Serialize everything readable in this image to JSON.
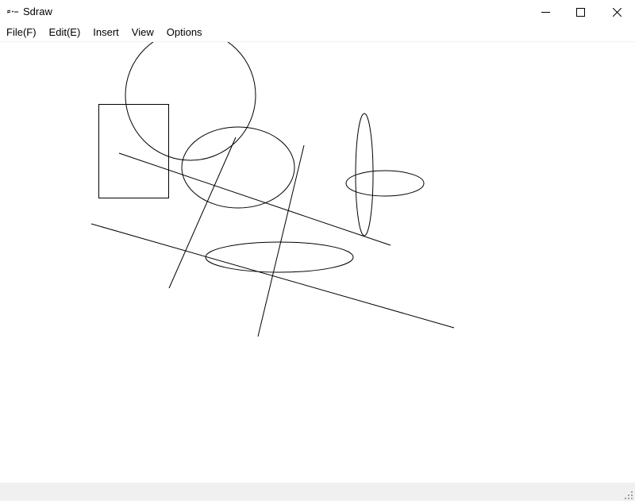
{
  "window": {
    "title": "Sdraw",
    "app_icon": "sdraw-app-icon",
    "controls": {
      "minimize_icon": "minimize-icon",
      "maximize_icon": "maximize-icon",
      "close_icon": "close-icon"
    }
  },
  "menu": {
    "items": [
      {
        "label": "File(F)"
      },
      {
        "label": "Edit(E)"
      },
      {
        "label": "Insert"
      },
      {
        "label": "View"
      },
      {
        "label": "Options"
      }
    ]
  },
  "canvas": {
    "background": "#ffffff",
    "stroke": "#000000",
    "shapes": [
      {
        "type": "ellipse",
        "name": "shape-ellipse-large-circle"
      },
      {
        "type": "rect",
        "name": "shape-rectangle"
      },
      {
        "type": "ellipse",
        "name": "shape-ellipse-middle"
      },
      {
        "type": "ellipse",
        "name": "shape-ellipse-vertical"
      },
      {
        "type": "ellipse",
        "name": "shape-ellipse-small-horizontal"
      },
      {
        "type": "ellipse",
        "name": "shape-ellipse-flat"
      },
      {
        "type": "line",
        "name": "shape-line-1"
      },
      {
        "type": "line",
        "name": "shape-line-2"
      },
      {
        "type": "line",
        "name": "shape-line-3"
      },
      {
        "type": "line",
        "name": "shape-line-4"
      }
    ]
  },
  "statusbar": {
    "text": "",
    "grip_icon": "resize-grip-icon"
  }
}
